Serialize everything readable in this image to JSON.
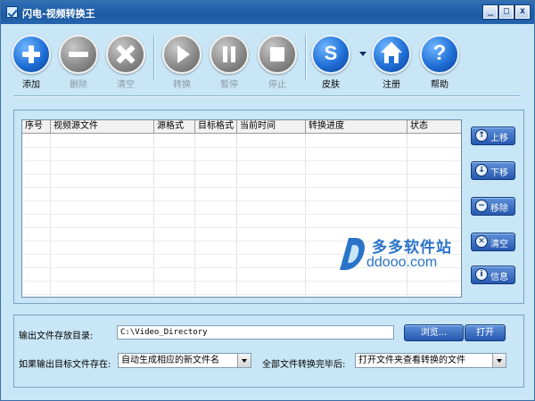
{
  "window": {
    "title": "闪电-视频转换王",
    "minimize_glyph": "_",
    "maximize_glyph": "□",
    "close_glyph": "x"
  },
  "toolbar": {
    "add": "添加",
    "delete": "删除",
    "clear": "清空",
    "convert": "转换",
    "pause": "暂停",
    "stop": "停止",
    "skin": "皮肤",
    "skin_letter": "S",
    "register": "注册",
    "help": "帮助",
    "help_glyph": "?"
  },
  "table": {
    "columns": [
      "序号",
      "视频源文件",
      "源格式",
      "目标格式",
      "当前时间",
      "转换进度",
      "状态"
    ],
    "rows": []
  },
  "side_buttons": {
    "move_up": "上移",
    "move_down": "下移",
    "remove": "移除",
    "clear": "清空",
    "info": "信息",
    "up_glyph": "↑",
    "down_glyph": "↓",
    "remove_glyph": "−",
    "clear_glyph": "✕",
    "info_glyph": "i"
  },
  "watermark": {
    "cn": "多多软件站",
    "en": "ddooo.com"
  },
  "settings": {
    "output_dir_label": "输出文件存放目录:",
    "output_dir_value": "C:\\Video_Directory",
    "browse": "浏览...",
    "open": "打开",
    "if_exists_label": "如果输出目标文件存在:",
    "if_exists_value": "自动生成相应的新文件名",
    "after_all_label": "全部文件转换完毕后:",
    "after_all_value": "打开文件夹查看转换的文件"
  },
  "colors": {
    "window_bg": "#c9e6f6",
    "titlebar": "#1d5aa3",
    "button_blue": "#2558b0",
    "watermark_blue": "#2a73c9"
  }
}
